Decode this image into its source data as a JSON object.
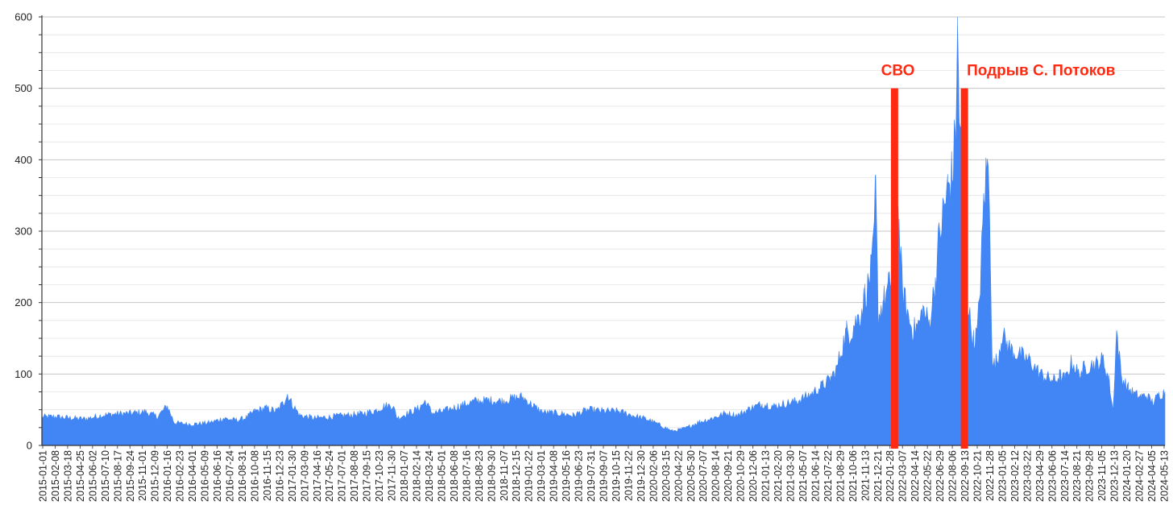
{
  "chart_data": {
    "type": "area",
    "title": "",
    "xlabel": "",
    "ylabel": "",
    "ylim": [
      0,
      600
    ],
    "yticks": [
      0,
      100,
      200,
      300,
      400,
      500,
      600
    ],
    "grid": true,
    "colors": {
      "series": "#4285f4",
      "annotation": "#ff2a12",
      "grid": "#cfcfcf",
      "axis": "#333333"
    },
    "x_tick_labels": [
      "2015-01-01",
      "2015-02-08",
      "2015-03-18",
      "2015-04-25",
      "2015-06-02",
      "2015-07-10",
      "2015-08-17",
      "2015-09-24",
      "2015-11-01",
      "2015-12-09",
      "2016-01-16",
      "2016-02-23",
      "2016-04-01",
      "2016-05-09",
      "2016-06-16",
      "2016-07-24",
      "2016-08-31",
      "2016-10-08",
      "2016-11-15",
      "2016-12-23",
      "2017-01-30",
      "2017-03-09",
      "2017-04-16",
      "2017-05-24",
      "2017-07-01",
      "2017-08-08",
      "2017-09-15",
      "2017-10-23",
      "2017-11-30",
      "2018-01-07",
      "2018-02-14",
      "2018-03-24",
      "2018-05-01",
      "2018-06-08",
      "2018-07-16",
      "2018-08-23",
      "2018-09-30",
      "2018-11-07",
      "2018-12-15",
      "2019-01-22",
      "2019-03-01",
      "2019-04-08",
      "2019-05-16",
      "2019-06-23",
      "2019-07-31",
      "2019-09-07",
      "2019-10-15",
      "2019-11-22",
      "2019-12-30",
      "2020-02-06",
      "2020-03-15",
      "2020-04-22",
      "2020-05-30",
      "2020-07-07",
      "2020-08-14",
      "2020-09-21",
      "2020-10-29",
      "2020-12-06",
      "2021-01-13",
      "2021-02-20",
      "2021-03-30",
      "2021-05-07",
      "2021-06-14",
      "2021-07-22",
      "2021-08-29",
      "2021-10-06",
      "2021-11-13",
      "2021-12-21",
      "2022-01-28",
      "2022-03-07",
      "2022-04-14",
      "2022-05-22",
      "2022-06-29",
      "2022-08-06",
      "2022-09-13",
      "2022-10-21",
      "2022-11-28",
      "2023-01-05",
      "2023-02-12",
      "2023-03-22",
      "2023-04-29",
      "2023-06-06",
      "2023-07-14",
      "2023-08-21",
      "2023-09-28",
      "2023-11-05",
      "2023-12-13",
      "2024-01-20",
      "2024-02-27",
      "2024-04-05",
      "2024-05-13"
    ],
    "series": [
      {
        "values": [
          [
            "2015-01-01",
            40
          ],
          [
            "2015-02-15",
            40
          ],
          [
            "2015-04-01",
            38
          ],
          [
            "2015-05-15",
            37
          ],
          [
            "2015-07-01",
            42
          ],
          [
            "2015-08-15",
            44
          ],
          [
            "2015-10-01",
            45
          ],
          [
            "2015-11-15",
            47
          ],
          [
            "2015-12-20",
            40
          ],
          [
            "2016-01-20",
            55
          ],
          [
            "2016-02-10",
            32
          ],
          [
            "2016-03-15",
            30
          ],
          [
            "2016-04-20",
            30
          ],
          [
            "2016-06-01",
            32
          ],
          [
            "2016-07-10",
            38
          ],
          [
            "2016-08-15",
            35
          ],
          [
            "2016-09-15",
            38
          ],
          [
            "2016-10-15",
            48
          ],
          [
            "2016-11-15",
            52
          ],
          [
            "2016-12-20",
            48
          ],
          [
            "2017-01-10",
            60
          ],
          [
            "2017-01-22",
            72
          ],
          [
            "2017-02-05",
            58
          ],
          [
            "2017-03-01",
            42
          ],
          [
            "2017-04-16",
            38
          ],
          [
            "2017-06-01",
            40
          ],
          [
            "2017-07-15",
            42
          ],
          [
            "2017-09-01",
            44
          ],
          [
            "2017-10-15",
            48
          ],
          [
            "2017-11-15",
            55
          ],
          [
            "2017-12-10",
            56
          ],
          [
            "2017-12-25",
            38
          ],
          [
            "2018-01-20",
            44
          ],
          [
            "2018-03-01",
            52
          ],
          [
            "2018-03-20",
            62
          ],
          [
            "2018-04-10",
            45
          ],
          [
            "2018-05-15",
            48
          ],
          [
            "2018-07-01",
            55
          ],
          [
            "2018-08-20",
            62
          ],
          [
            "2018-10-01",
            63
          ],
          [
            "2018-11-10",
            62
          ],
          [
            "2018-12-15",
            66
          ],
          [
            "2019-01-10",
            68
          ],
          [
            "2019-02-15",
            55
          ],
          [
            "2019-03-15",
            46
          ],
          [
            "2019-05-01",
            45
          ],
          [
            "2019-06-15",
            42
          ],
          [
            "2019-08-01",
            50
          ],
          [
            "2019-09-15",
            48
          ],
          [
            "2019-11-01",
            48
          ],
          [
            "2019-12-15",
            42
          ],
          [
            "2020-02-01",
            36
          ],
          [
            "2020-03-10",
            28
          ],
          [
            "2020-04-15",
            20
          ],
          [
            "2020-05-25",
            24
          ],
          [
            "2020-07-01",
            32
          ],
          [
            "2020-08-15",
            38
          ],
          [
            "2020-09-25",
            45
          ],
          [
            "2020-11-01",
            42
          ],
          [
            "2020-12-10",
            52
          ],
          [
            "2021-01-15",
            58
          ],
          [
            "2021-02-20",
            55
          ],
          [
            "2021-03-20",
            58
          ],
          [
            "2021-05-01",
            62
          ],
          [
            "2021-06-14",
            72
          ],
          [
            "2021-07-22",
            85
          ],
          [
            "2021-08-10",
            92
          ],
          [
            "2021-08-29",
            105
          ],
          [
            "2021-09-15",
            135
          ],
          [
            "2021-09-30",
            160
          ],
          [
            "2021-10-10",
            155
          ],
          [
            "2021-10-25",
            170
          ],
          [
            "2021-11-13",
            185
          ],
          [
            "2021-11-25",
            210
          ],
          [
            "2021-12-10",
            230
          ],
          [
            "2021-12-21",
            270
          ],
          [
            "2021-12-28",
            360
          ],
          [
            "2022-01-05",
            180
          ],
          [
            "2022-01-20",
            200
          ],
          [
            "2022-02-05",
            220
          ],
          [
            "2022-02-20",
            240
          ],
          [
            "2022-03-01",
            370
          ],
          [
            "2022-03-10",
            300
          ],
          [
            "2022-03-20",
            220
          ],
          [
            "2022-04-05",
            185
          ],
          [
            "2022-04-20",
            160
          ],
          [
            "2022-05-10",
            170
          ],
          [
            "2022-05-22",
            190
          ],
          [
            "2022-06-10",
            170
          ],
          [
            "2022-06-29",
            230
          ],
          [
            "2022-07-10",
            290
          ],
          [
            "2022-07-25",
            330
          ],
          [
            "2022-08-06",
            360
          ],
          [
            "2022-08-20",
            380
          ],
          [
            "2022-08-30",
            440
          ],
          [
            "2022-09-05",
            580
          ],
          [
            "2022-09-10",
            470
          ],
          [
            "2022-09-20",
            380
          ],
          [
            "2022-10-01",
            220
          ],
          [
            "2022-10-15",
            170
          ],
          [
            "2022-10-25",
            145
          ],
          [
            "2022-11-05",
            160
          ],
          [
            "2022-11-15",
            240
          ],
          [
            "2022-11-25",
            350
          ],
          [
            "2022-12-05",
            390
          ],
          [
            "2022-12-12",
            360
          ],
          [
            "2022-12-20",
            110
          ],
          [
            "2023-01-05",
            120
          ],
          [
            "2023-01-20",
            155
          ],
          [
            "2023-02-05",
            140
          ],
          [
            "2023-02-25",
            130
          ],
          [
            "2023-03-22",
            125
          ],
          [
            "2023-04-15",
            118
          ],
          [
            "2023-05-15",
            100
          ],
          [
            "2023-06-06",
            95
          ],
          [
            "2023-07-01",
            90
          ],
          [
            "2023-07-14",
            98
          ],
          [
            "2023-08-01",
            92
          ],
          [
            "2023-08-21",
            118
          ],
          [
            "2023-09-10",
            100
          ],
          [
            "2023-09-28",
            108
          ],
          [
            "2023-10-15",
            112
          ],
          [
            "2023-11-05",
            115
          ],
          [
            "2023-11-25",
            120
          ],
          [
            "2023-12-13",
            90
          ],
          [
            "2023-12-25",
            48
          ],
          [
            "2024-01-05",
            160
          ],
          [
            "2024-01-20",
            95
          ],
          [
            "2024-02-10",
            80
          ],
          [
            "2024-02-27",
            72
          ],
          [
            "2024-03-20",
            68
          ],
          [
            "2024-04-05",
            70
          ],
          [
            "2024-04-25",
            60
          ],
          [
            "2024-05-13",
            70
          ],
          [
            "2024-06-01",
            75
          ]
        ]
      }
    ],
    "annotations": [
      {
        "label": "СВО",
        "date": "2022-02-24",
        "value": 500
      },
      {
        "label": "Подрыв С. Потоков",
        "date": "2022-09-26",
        "value": 500
      }
    ]
  }
}
